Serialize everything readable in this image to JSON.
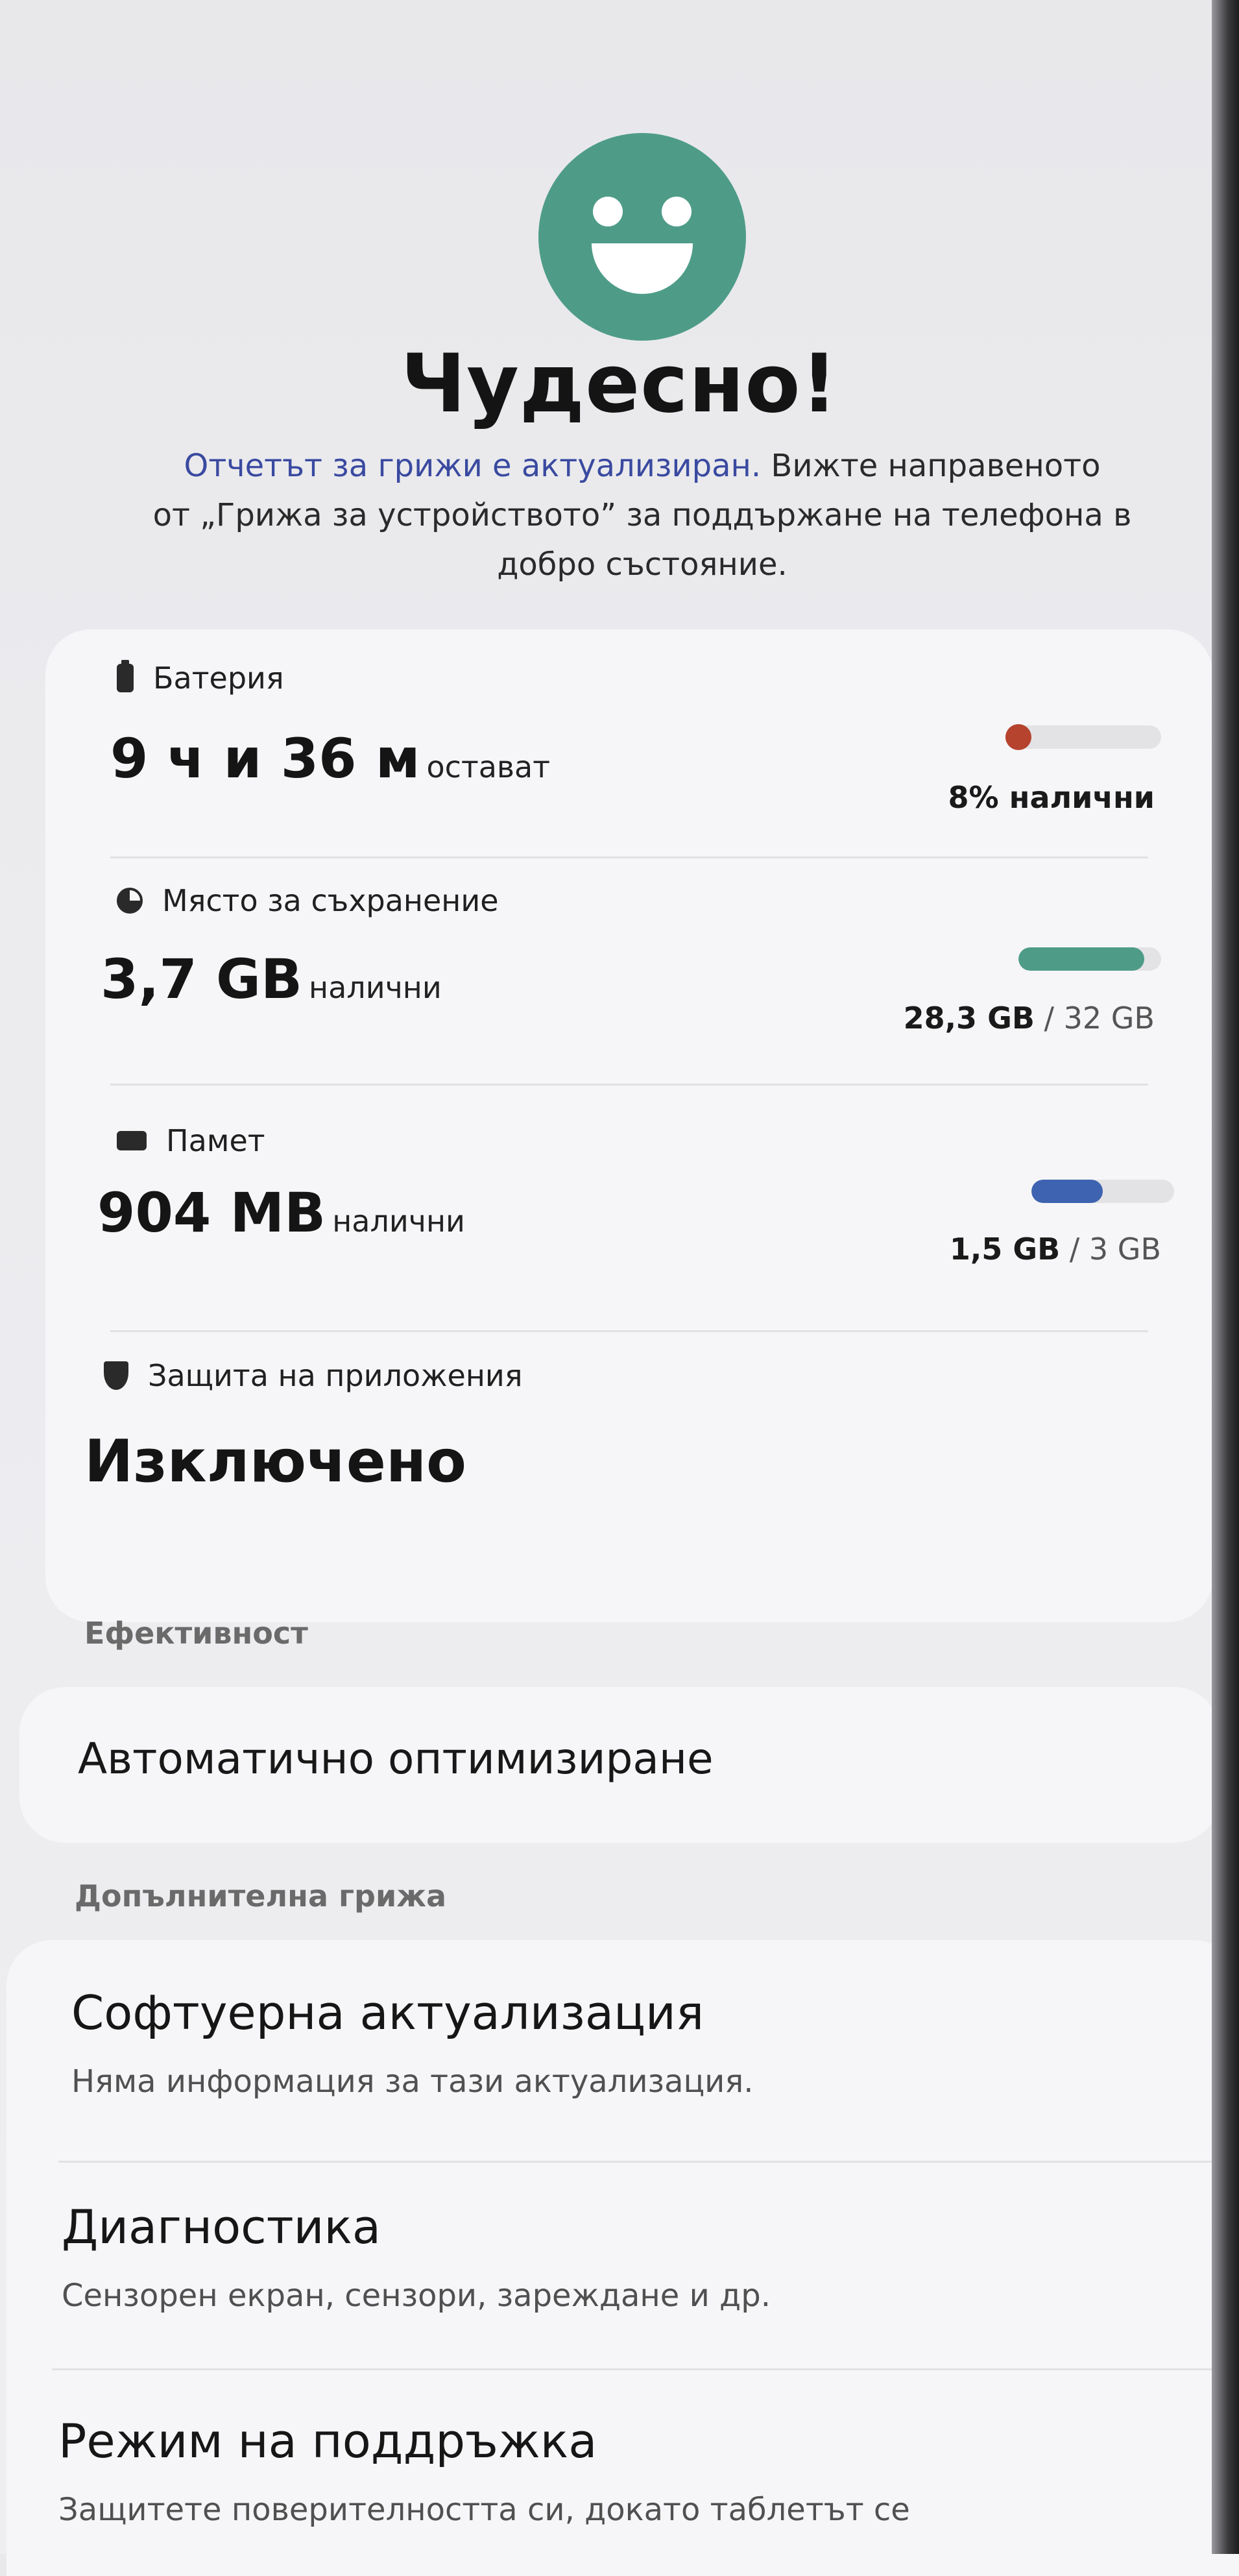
{
  "hero": {
    "icon": "smiley-icon",
    "title": "Чудесно!",
    "desc_link": "Отчетът за грижи е актуализиран.",
    "desc_line1_rest": " Вижте направеното",
    "desc_line2": "от „Грижа за устройството” за поддържане на телефона в",
    "desc_line3": "добро състояние."
  },
  "battery": {
    "label": "Батерия",
    "value": "9 ч и 36 м",
    "suffix": "остават",
    "status": "8% налични",
    "level_percent": 8,
    "color": "#b5432e"
  },
  "storage": {
    "label": "Място за съхранение",
    "value": "3,7 GB",
    "suffix": "налични",
    "used": "28,3 GB",
    "total": " / 32 GB",
    "used_fraction": 0.884,
    "color": "#4e9c88"
  },
  "memory": {
    "label": "Памет",
    "value": "904 MB",
    "suffix": "налични",
    "used": "1,5 GB",
    "total": " / 3 GB",
    "used_fraction": 0.5,
    "color": "#3e63b0"
  },
  "app_protection": {
    "label": "Защита на приложения",
    "status": "Изключено"
  },
  "efficiency": {
    "header": "Ефективност",
    "item": "Автоматично оптимизиране"
  },
  "additional_care": {
    "header": "Допълнителна грижа",
    "items": [
      {
        "title": "Софтуерна актуализация",
        "sub": "Няма информация за тази актуализация."
      },
      {
        "title": "Диагностика",
        "sub": "Сензорен екран, сензори, зареждане и др."
      },
      {
        "title": "Режим на поддръжка",
        "sub": "Защитете поверителността си, докато таблетът се"
      }
    ]
  }
}
